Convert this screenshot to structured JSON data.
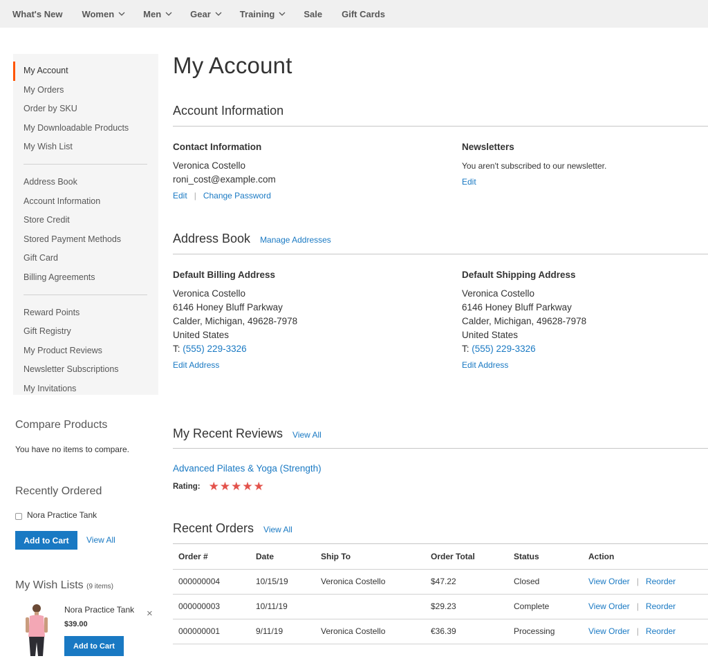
{
  "nav": {
    "items": [
      {
        "label": "What's New",
        "has_dropdown": false
      },
      {
        "label": "Women",
        "has_dropdown": true
      },
      {
        "label": "Men",
        "has_dropdown": true
      },
      {
        "label": "Gear",
        "has_dropdown": true
      },
      {
        "label": "Training",
        "has_dropdown": true
      },
      {
        "label": "Sale",
        "has_dropdown": false
      },
      {
        "label": "Gift Cards",
        "has_dropdown": false
      }
    ]
  },
  "sidebar": {
    "groups": [
      [
        "My Account",
        "My Orders",
        "Order by SKU",
        "My Downloadable Products",
        "My Wish List"
      ],
      [
        "Address Book",
        "Account Information",
        "Store Credit",
        "Stored Payment Methods",
        "Gift Card",
        "Billing Agreements"
      ],
      [
        "Reward Points",
        "Gift Registry",
        "My Product Reviews",
        "Newsletter Subscriptions",
        "My Invitations"
      ]
    ],
    "active": "My Account",
    "accent_color": "#ff5501"
  },
  "compare": {
    "title": "Compare Products",
    "empty_text": "You have no items to compare."
  },
  "recently_ordered": {
    "title": "Recently Ordered",
    "item": "Nora Practice Tank",
    "add_to_cart": "Add to Cart",
    "view_all": "View All"
  },
  "wishlist": {
    "title": "My Wish Lists",
    "count": "(9 items)",
    "item_name": "Nora Practice Tank",
    "item_price": "$39.00",
    "add_to_cart": "Add to Cart",
    "remove_icon": "close-icon"
  },
  "main": {
    "page_title": "My Account",
    "account_info": {
      "title": "Account Information",
      "contact": {
        "title": "Contact Information",
        "name": "Veronica Costello",
        "email": "roni_cost@example.com",
        "edit": "Edit",
        "change_password": "Change Password"
      },
      "newsletters": {
        "title": "Newsletters",
        "text": "You aren't subscribed to our newsletter.",
        "edit": "Edit"
      }
    },
    "address_book": {
      "title": "Address Book",
      "manage": "Manage Addresses",
      "billing": {
        "title": "Default Billing Address",
        "name": "Veronica Costello",
        "street": "6146 Honey Bluff Parkway",
        "city": "Calder, Michigan, 49628-7978",
        "country": "United States",
        "phone_prefix": "T:",
        "phone": "(555) 229-3326",
        "edit": "Edit Address"
      },
      "shipping": {
        "title": "Default Shipping Address",
        "name": "Veronica Costello",
        "street": "6146 Honey Bluff Parkway",
        "city": "Calder, Michigan, 49628-7978",
        "country": "United States",
        "phone_prefix": "T:",
        "phone": "(555) 229-3326",
        "edit": "Edit Address"
      }
    },
    "reviews": {
      "title": "My Recent Reviews",
      "view_all": "View All",
      "product": "Advanced Pilates & Yoga (Strength)",
      "rating_label": "Rating:",
      "stars": 5,
      "star_color": "#e3524b"
    },
    "orders": {
      "title": "Recent Orders",
      "view_all": "View All",
      "columns": [
        "Order #",
        "Date",
        "Ship To",
        "Order Total",
        "Status",
        "Action"
      ],
      "rows": [
        {
          "order": "000000004",
          "date": "10/15/19",
          "ship_to": "Veronica Costello",
          "total": "$47.22",
          "status": "Closed",
          "view": "View Order",
          "reorder": "Reorder"
        },
        {
          "order": "000000003",
          "date": "10/11/19",
          "ship_to": "",
          "total": "$29.23",
          "status": "Complete",
          "view": "View Order",
          "reorder": "Reorder"
        },
        {
          "order": "000000001",
          "date": "9/11/19",
          "ship_to": "Veronica Costello",
          "total": "€36.39",
          "status": "Processing",
          "view": "View Order",
          "reorder": "Reorder"
        }
      ]
    }
  },
  "colors": {
    "link": "#1979c3",
    "nav_bg": "#f0f0f0",
    "sidebar_bg": "#f5f5f5"
  }
}
